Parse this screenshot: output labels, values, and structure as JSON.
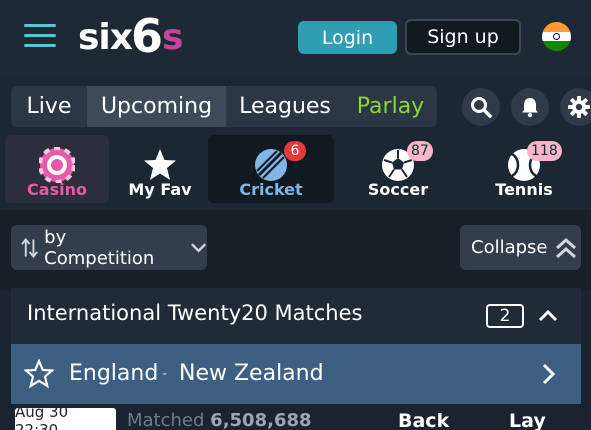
{
  "header": {
    "logo": {
      "part1": "six",
      "part2": "6",
      "part3": "s"
    },
    "login_label": "Login",
    "signup_label": "Sign up"
  },
  "tabs": [
    {
      "label": "Live"
    },
    {
      "label": "Upcoming",
      "active": true
    },
    {
      "label": "Leagues"
    },
    {
      "label": "Parlay",
      "color": "#8fd33a"
    }
  ],
  "categories": [
    {
      "label": "Casino",
      "icon": "casino-chip-icon",
      "color": "#e75aa8"
    },
    {
      "label": "My Fav",
      "icon": "star-icon",
      "color": "#ffffff"
    },
    {
      "label": "Cricket",
      "icon": "cricket-ball-icon",
      "badge": "6",
      "color": "#7fb6e6",
      "active": true
    },
    {
      "label": "Soccer",
      "icon": "soccer-ball-icon",
      "badge": "87",
      "color": "#ffffff"
    },
    {
      "label": "Tennis",
      "icon": "tennis-ball-icon",
      "badge": "118",
      "color": "#ffffff"
    }
  ],
  "controls": {
    "sort_label": "by Competition",
    "collapse_label": "Collapse"
  },
  "competition": {
    "title": "International Twenty20 Matches",
    "count": "2"
  },
  "match": {
    "home": "England",
    "separator": "-",
    "away": "New Zealand",
    "datetime": "Aug 30 22:30",
    "matched_label": "Matched",
    "matched_value": "6,508,688",
    "back_label": "Back",
    "lay_label": "Lay"
  },
  "colors": {
    "accent": "#2e9fb3",
    "brand_pink": "#c7439b",
    "parlay_green": "#8fd33a",
    "match_row": "#3c5f82"
  }
}
